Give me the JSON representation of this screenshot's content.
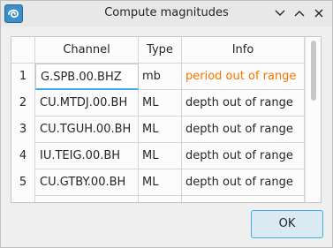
{
  "window": {
    "title": "Compute magnitudes"
  },
  "table": {
    "headers": [
      "Channel",
      "Type",
      "Info"
    ],
    "rows": [
      {
        "num": "1",
        "channel": "G.SPB.00.BHZ",
        "type": "mb",
        "info": "period out of range"
      },
      {
        "num": "2",
        "channel": "CU.MTDJ.00.BH",
        "type": "ML",
        "info": "depth out of range"
      },
      {
        "num": "3",
        "channel": "CU.TGUH.00.BH",
        "type": "ML",
        "info": "depth out of range"
      },
      {
        "num": "4",
        "channel": "IU.TEIG.00.BH",
        "type": "ML",
        "info": "depth out of range"
      },
      {
        "num": "5",
        "channel": "CU.GTBY.00.BH",
        "type": "ML",
        "info": "depth out of range"
      }
    ]
  },
  "buttons": {
    "ok": "OK"
  },
  "colors": {
    "accent": "#3daee9",
    "warning": "#f67400"
  }
}
